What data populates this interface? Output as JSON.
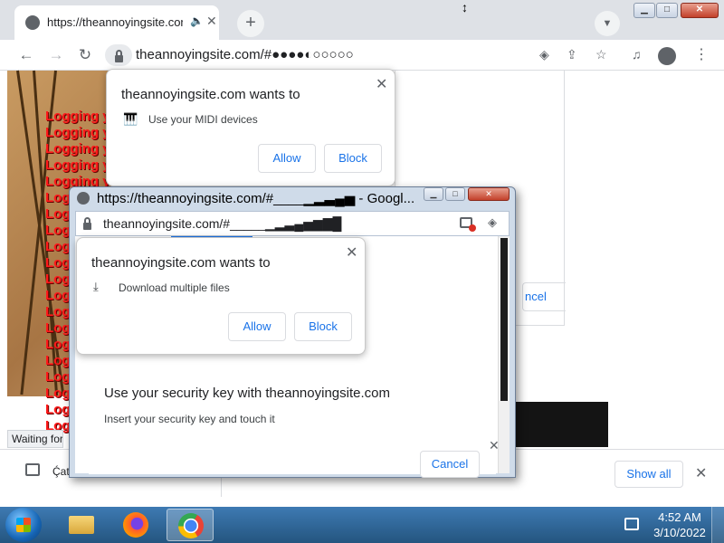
{
  "main_tab": {
    "title": "https://theannoyingsite.com"
  },
  "main_url": "theannoyingsite.com/#●●●●◐○○○○○",
  "log_text": "Logging you out...",
  "status_text": "Waiting for",
  "download_item": "Ḉat",
  "show_all_label": "Show all",
  "midi_prompt": {
    "header": "theannoyingsite.com wants to",
    "permission": "Use your MIDI devices",
    "allow_label": "Allow",
    "block_label": "Block"
  },
  "bg_cancel_label": "ncel",
  "popup": {
    "title": "https://theannoyingsite.com/#____▁▂▃▄▅ - Googl...",
    "url": "theannoyingsite.com/#_____▁▂▃▄▅▆▇█"
  },
  "download_prompt": {
    "header": "theannoyingsite.com wants to",
    "permission": "Download multiple files",
    "allow_label": "Allow",
    "block_label": "Block"
  },
  "security_key": {
    "title": "Use your security key with theannoyingsite.com",
    "body": "Insert your security key and touch it",
    "cancel_label": "Cancel"
  },
  "clock": {
    "time": "4:52 AM",
    "date": "3/10/2022"
  },
  "icons": [
    "globe-icon",
    "speaker-icon",
    "close-icon",
    "plus-icon",
    "chevron-down-icon",
    "back-arrow-icon",
    "forward-arrow-icon",
    "reload-icon",
    "lock-icon",
    "eye-icon",
    "share-icon",
    "star-icon",
    "media-icon",
    "profile-icon",
    "kebab-menu-icon",
    "piano-icon",
    "download-icon",
    "image-icon"
  ]
}
